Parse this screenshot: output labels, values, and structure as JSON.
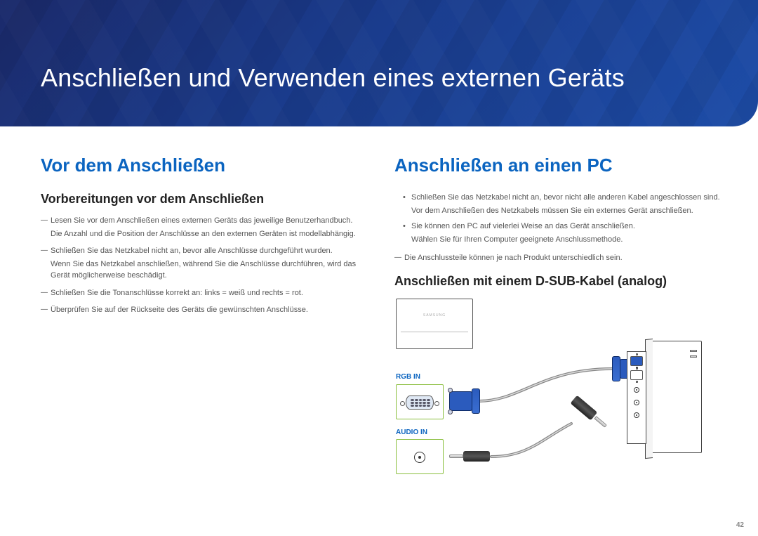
{
  "banner": {
    "title": "Anschließen und Verwenden eines externen Geräts"
  },
  "left": {
    "heading": "Vor dem Anschließen",
    "subheading": "Vorbereitungen vor dem Anschließen",
    "items": [
      {
        "main": "Lesen Sie vor dem Anschließen eines externen Geräts das jeweilige Benutzerhandbuch.",
        "sub": "Die Anzahl und die Position der Anschlüsse an den externen Geräten ist modellabhängig."
      },
      {
        "main": "Schließen Sie das Netzkabel nicht an, bevor alle Anschlüsse durchgeführt wurden.",
        "sub": "Wenn Sie das Netzkabel anschließen, während Sie die Anschlüsse durchführen, wird das Gerät möglicherweise beschädigt."
      },
      {
        "main": "Schließen Sie die Tonanschlüsse korrekt an: links = weiß und rechts = rot."
      },
      {
        "main": "Überprüfen Sie auf der Rückseite des Geräts die gewünschten Anschlüsse."
      }
    ]
  },
  "right": {
    "heading": "Anschließen an einen PC",
    "bullets": [
      {
        "main": "Schließen Sie das Netzkabel nicht an, bevor nicht alle anderen Kabel angeschlossen sind.",
        "sub": "Vor dem Anschließen des Netzkabels müssen Sie ein externes Gerät anschließen."
      },
      {
        "main": "Sie können den PC auf vielerlei Weise an das Gerät anschließen.",
        "sub": "Wählen Sie für Ihren Computer geeignete Anschlussmethode."
      }
    ],
    "dash_note": "Die Anschlussteile können je nach Produkt unterschiedlich sein.",
    "subheading": "Anschließen mit einem D-SUB-Kabel (analog)",
    "diagram": {
      "monitor_brand": "SAMSUNG",
      "rgb_label": "RGB IN",
      "audio_label": "AUDIO IN"
    }
  },
  "page_number": "42"
}
